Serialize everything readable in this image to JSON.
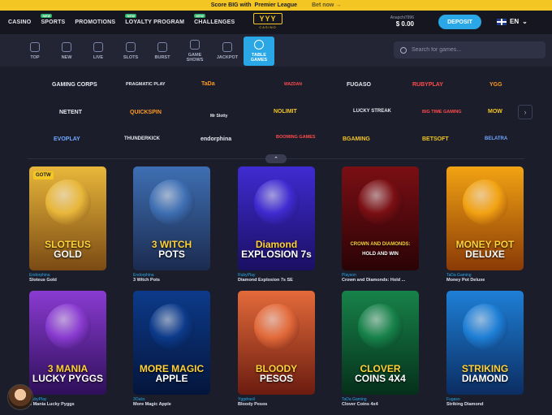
{
  "banner": {
    "text": "Score BIG with",
    "strong": "Premier League",
    "cta": "Bet now →"
  },
  "nav": {
    "items": [
      {
        "label": "CASINO",
        "badge": ""
      },
      {
        "label": "SPORTS",
        "badge": "NEW"
      },
      {
        "label": "PROMOTIONS",
        "badge": ""
      },
      {
        "label": "LOYALTY PROGRAM",
        "badge": "NEW"
      },
      {
        "label": "CHALLENGES",
        "badge": "NEW"
      }
    ],
    "logo": {
      "mark": "YYY",
      "sub": "CASINO"
    },
    "user": "Anapchi7996",
    "balance": "$ 0.00",
    "deposit": "DEPOSIT",
    "lang": "EN"
  },
  "categories": [
    {
      "label": "TOP",
      "icon": "trend-icon"
    },
    {
      "label": "NEW",
      "icon": "new-icon"
    },
    {
      "label": "LIVE",
      "icon": "live-icon"
    },
    {
      "label": "SLOTS",
      "icon": "slots-icon"
    },
    {
      "label": "BURST",
      "icon": "burst-icon"
    },
    {
      "label": "GAME SHOWS",
      "icon": "game-shows-icon"
    },
    {
      "label": "JACKPOT",
      "icon": "jackpot-icon"
    },
    {
      "label": "TABLE GAMES",
      "icon": "table-games-icon"
    }
  ],
  "search": {
    "placeholder": "Search for games..."
  },
  "providers": {
    "row1": [
      "GAMING CORPS",
      "PRAGMATIC PLAY",
      "TaDa",
      "WAZDAN",
      "FUGASO",
      "RUBYPLAY",
      "YGG"
    ],
    "row2": [
      "NETENT",
      "QUICKSPIN",
      "Mr Slotty",
      "NOLIMIT",
      "LUCKY STREAK",
      "BIG TIME GAMING",
      "MOW"
    ],
    "row3": [
      "EVOPLAY",
      "THUNDERKICK",
      "endorphina",
      "BOOMING GAMES",
      "BGAMING",
      "BETSOFT",
      "BELATRA"
    ]
  },
  "games": [
    {
      "provider": "Endorphina",
      "name": "Sloteus Gold",
      "line1": "SLOTEUS",
      "line2": "GOLD",
      "badge": "GOTW",
      "colors": [
        "#e8b73a",
        "#7a4a14"
      ]
    },
    {
      "provider": "Endorphina",
      "name": "3 Witch Pots",
      "line1": "3 WITCH",
      "line2": "POTS",
      "badge": "",
      "colors": [
        "#3e6fb3",
        "#1b2b4f"
      ]
    },
    {
      "provider": "RubyPlay",
      "name": "Diamond Explosion 7s SE",
      "line1": "Diamond",
      "line2": "EXPLOSION 7s",
      "badge": "",
      "colors": [
        "#3f2bd1",
        "#1b0f63"
      ]
    },
    {
      "provider": "Playson",
      "name": "Crown and Diamonds: Hold ...",
      "line1": "CROWN AND DIAMONDS:",
      "line2": "HOLD AND WIN",
      "badge": "",
      "colors": [
        "#7a0f14",
        "#2a0306"
      ]
    },
    {
      "provider": "TaDa Gaming",
      "name": "Money Pot Deluxe",
      "line1": "MONEY POT",
      "line2": "DELUXE",
      "badge": "",
      "colors": [
        "#f2a313",
        "#8a3a06"
      ]
    },
    {
      "provider": "RubyPlay",
      "name": "3 Mania Lucky Pyggs",
      "line1": "3 MANIA",
      "line2": "LUCKY PYGGS",
      "badge": "",
      "colors": [
        "#8a3bd1",
        "#2e0f5a"
      ]
    },
    {
      "provider": "3Oaks",
      "name": "More Magic Apple",
      "line1": "MORE MAGIC",
      "line2": "APPLE",
      "badge": "",
      "colors": [
        "#0c3a8a",
        "#04153b"
      ]
    },
    {
      "provider": "Yggdrasil",
      "name": "Bloody Pesos",
      "line1": "BLOODY",
      "line2": "PESOS",
      "badge": "",
      "colors": [
        "#e36a3a",
        "#6b1c10"
      ]
    },
    {
      "provider": "TaDa Gaming",
      "name": "Clover Coins 4x4",
      "line1": "CLOVER",
      "line2": "COINS 4X4",
      "badge": "",
      "colors": [
        "#17824a",
        "#05301a"
      ]
    },
    {
      "provider": "Fugaso",
      "name": "Striking Diamond",
      "line1": "STRIKING",
      "line2": "DIAMOND",
      "badge": "",
      "colors": [
        "#1e7fd6",
        "#0b2d62"
      ]
    }
  ]
}
